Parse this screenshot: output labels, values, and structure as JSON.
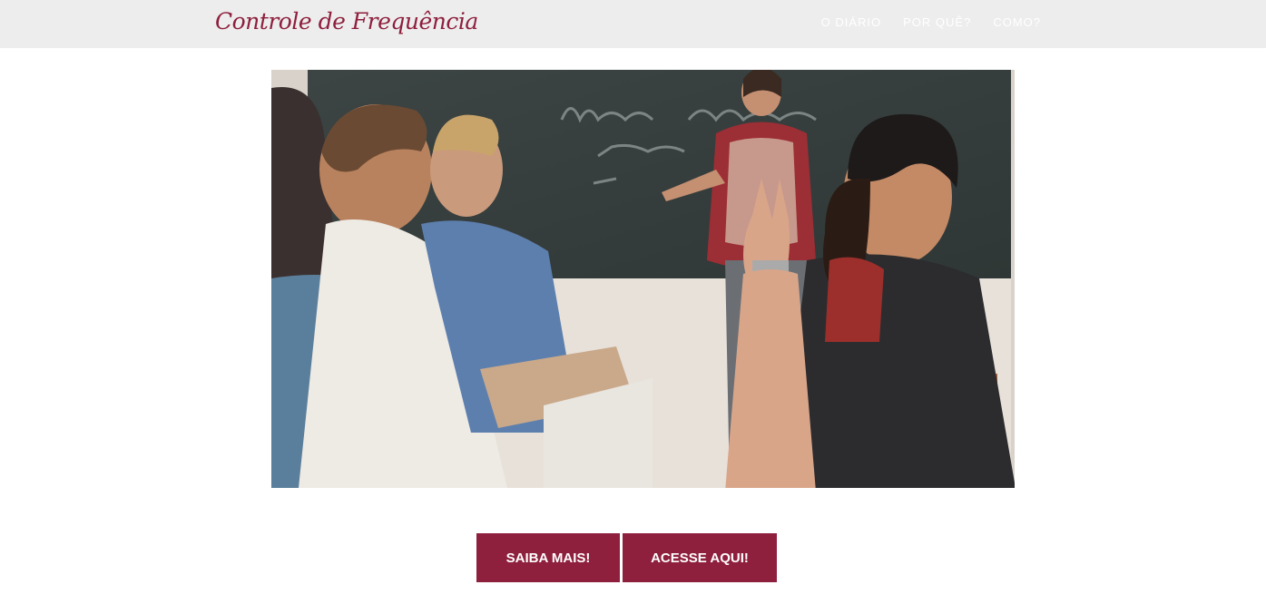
{
  "brand": {
    "title": "Controle de Frequência"
  },
  "nav": {
    "items": [
      {
        "label": "O DIÁRIO"
      },
      {
        "label": "POR QUÊ?"
      },
      {
        "label": "COMO?"
      }
    ]
  },
  "hero": {
    "image_icon": "classroom-photo"
  },
  "actions": {
    "primary_label": "SAIBA MAIS!",
    "secondary_label": "ACESSE AQUI!"
  },
  "colors": {
    "accent": "#8e1f3d",
    "navbar_bg": "#ededed"
  }
}
